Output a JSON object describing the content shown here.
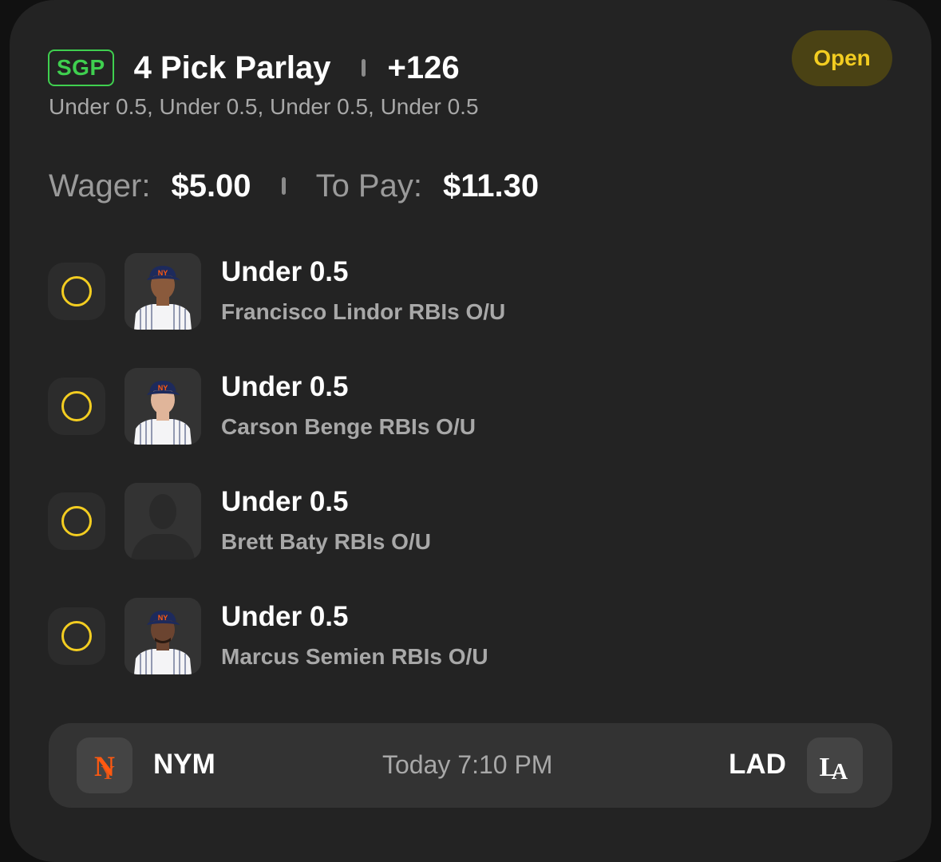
{
  "bet": {
    "badge": "SGP",
    "title": "4 Pick Parlay",
    "odds": "+126",
    "subtitle": "Under 0.5, Under 0.5, Under 0.5, Under 0.5",
    "status": "Open"
  },
  "wager": {
    "wager_label": "Wager:",
    "wager_value": "$5.00",
    "pay_label": "To Pay:",
    "pay_value": "$11.30"
  },
  "picks": [
    {
      "selection": "Under 0.5",
      "market": "Francisco Lindor RBIs O/U",
      "avatar": "player-headshot",
      "skin": "#8a5a3c"
    },
    {
      "selection": "Under 0.5",
      "market": "Carson Benge RBIs O/U",
      "avatar": "player-headshot",
      "skin": "#e0b59a"
    },
    {
      "selection": "Under 0.5",
      "market": "Brett Baty RBIs O/U",
      "avatar": "placeholder-silhouette",
      "skin": ""
    },
    {
      "selection": "Under 0.5",
      "market": "Marcus Semien RBIs O/U",
      "avatar": "player-headshot",
      "skin": "#6b4430"
    }
  ],
  "game": {
    "home_abbr": "NYM",
    "home_logo": "mets-logo",
    "time": "Today 7:10 PM",
    "away_abbr": "LAD",
    "away_logo": "dodgers-logo"
  },
  "colors": {
    "background": "#232323",
    "accent_yellow": "#f3cd21",
    "sgp_green": "#3fcf4f",
    "mets_orange": "#ff5910",
    "pinstripe_blue": "#1d2a5c"
  }
}
